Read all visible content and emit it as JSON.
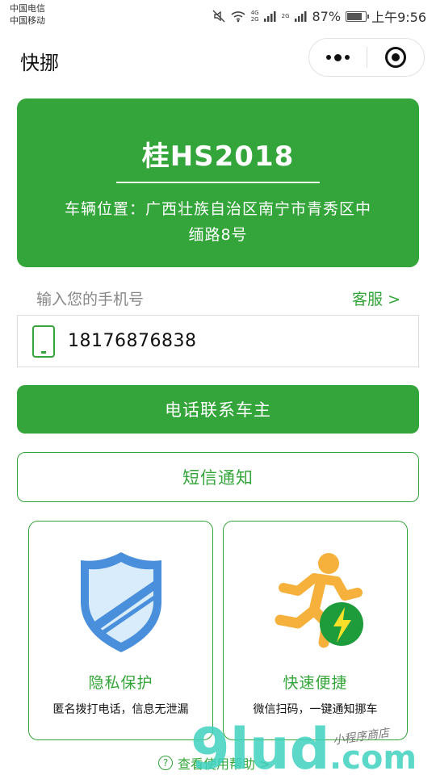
{
  "status_bar": {
    "carrier_1": "中国电信",
    "carrier_2": "中国移动",
    "net_1_top": "4G",
    "net_1_bottom": "2G",
    "net_2": "2G",
    "battery_percent": "87%",
    "battery_level": 0.87,
    "time": "上午9:56"
  },
  "nav": {
    "title": "快挪"
  },
  "plate_card": {
    "plate": "桂HS2018",
    "location": "车辆位置：广西壮族自治区南宁市青秀区中缅路8号"
  },
  "phone": {
    "label": "输入您的手机号",
    "service_link": "客服 >",
    "value": "18176876838"
  },
  "buttons": {
    "call": "电话联系车主",
    "sms": "短信通知"
  },
  "features": [
    {
      "title": "隐私保护",
      "desc": "匿名拨打电话，信息无泄漏",
      "icon": "shield-icon"
    },
    {
      "title": "快速便捷",
      "desc": "微信扫码，一键通知挪车",
      "icon": "running-man-icon"
    }
  ],
  "help": {
    "label": "查看使用帮助 >",
    "icon_char": "?"
  },
  "watermark": {
    "brand": "9lud",
    "suffix": ".com",
    "caption": "小程序商店"
  },
  "colors": {
    "accent": "#34a53a",
    "watermark": "#3fd1c0"
  }
}
